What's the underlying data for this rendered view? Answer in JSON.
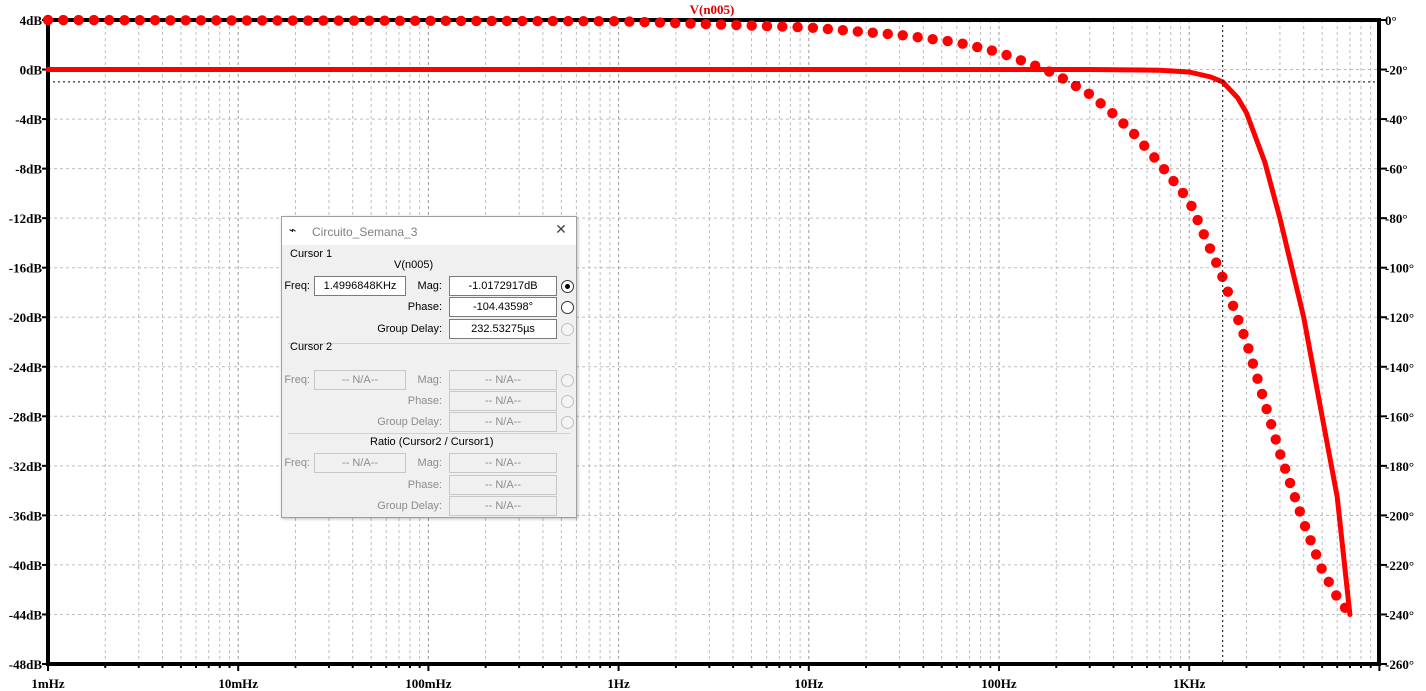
{
  "chart_data": {
    "type": "line",
    "title": "V(n005)",
    "x_scale": "log",
    "x_range_hz": [
      0.001,
      7000
    ],
    "x_ticks": [
      "1mHz",
      "10mHz",
      "100mHz",
      "1Hz",
      "10Hz",
      "100Hz",
      "1KHz"
    ],
    "y_left_ticks": [
      "4dB",
      "0dB",
      "-4dB",
      "-8dB",
      "-12dB",
      "-16dB",
      "-20dB",
      "-24dB",
      "-28dB",
      "-32dB",
      "-36dB",
      "-40dB",
      "-44dB",
      "-48dB"
    ],
    "y_left_range": [
      -48,
      4
    ],
    "y_right_ticks": [
      "0°",
      "-20°",
      "-40°",
      "-60°",
      "-80°",
      "-100°",
      "-120°",
      "-140°",
      "-160°",
      "-180°",
      "-200°",
      "-220°",
      "-240°",
      "-260°"
    ],
    "y_right_range": [
      -260,
      0
    ],
    "grid": true,
    "cursor_freq_hz": 1500,
    "cursor_level_db": -1.0,
    "series": [
      {
        "name": "magnitude",
        "style": "solid",
        "color": "#ff0000",
        "axis": "left",
        "x_hz": [
          0.001,
          100,
          300,
          700,
          1000,
          1300,
          1500,
          1800,
          2000,
          2500,
          3000,
          4000,
          5000,
          6000,
          7000
        ],
        "y_db": [
          0,
          0,
          0,
          -0.05,
          -0.2,
          -0.6,
          -1.0,
          -2.3,
          -3.5,
          -7.5,
          -12,
          -20,
          -28,
          -34.5,
          -44
        ]
      },
      {
        "name": "phase",
        "style": "dotted",
        "color": "#ff0000",
        "axis": "right",
        "x_hz": [
          0.001,
          1,
          10,
          30,
          60,
          100,
          150,
          200,
          300,
          400,
          500,
          700,
          1000,
          1500,
          2000,
          3000,
          4000,
          5000,
          6000,
          7000
        ],
        "y_deg": [
          0,
          -0.5,
          -3,
          -6,
          -9,
          -13,
          -18,
          -22,
          -30,
          -38,
          -45,
          -58,
          -73,
          -104,
          -130,
          -175,
          -203,
          -222,
          -233,
          -240
        ]
      }
    ]
  },
  "cursor_dialog": {
    "title": "Circuito_Semana_3",
    "cursor1": {
      "heading": "Cursor 1",
      "trace": "V(n005)",
      "freq_label": "Freq:",
      "freq_value": "1.4996848KHz",
      "mag_label": "Mag:",
      "mag_value": "-1.0172917dB",
      "phase_label": "Phase:",
      "phase_value": "-104.43598°",
      "gd_label": "Group Delay:",
      "gd_value": "232.53275µs"
    },
    "cursor2": {
      "heading": "Cursor 2",
      "freq_label": "Freq:",
      "freq_value": "-- N/A--",
      "mag_label": "Mag:",
      "mag_value": "-- N/A--",
      "phase_label": "Phase:",
      "phase_value": "-- N/A--",
      "gd_label": "Group Delay:",
      "gd_value": "-- N/A--"
    },
    "ratio": {
      "heading": "Ratio (Cursor2 / Cursor1)",
      "freq_label": "Freq:",
      "freq_value": "-- N/A--",
      "mag_label": "Mag:",
      "mag_value": "-- N/A--",
      "phase_label": "Phase:",
      "phase_value": "-- N/A--",
      "gd_label": "Group Delay:",
      "gd_value": "-- N/A--"
    }
  }
}
